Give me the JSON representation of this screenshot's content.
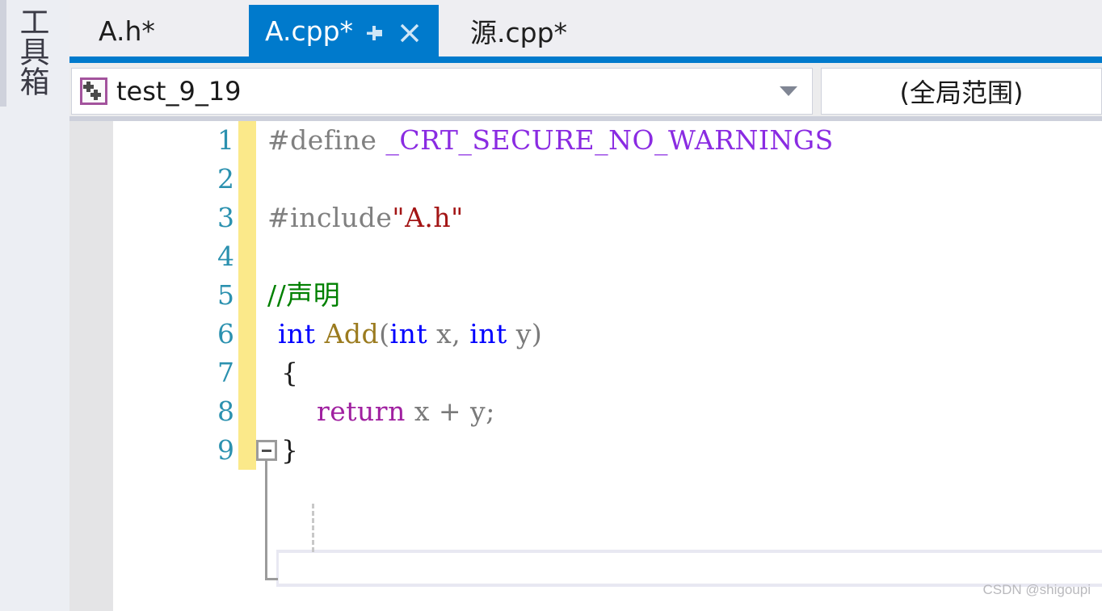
{
  "toolbox": {
    "label": "工具箱"
  },
  "tabs": [
    {
      "label": "A.h*",
      "active": false
    },
    {
      "label": "A.cpp*",
      "active": true
    },
    {
      "label": "源.cpp*",
      "active": false
    }
  ],
  "tab_buttons": {
    "pin_icon": "pin-icon",
    "close_icon": "close-icon"
  },
  "navbar": {
    "project_icon": "cpp-file-icon",
    "left_value": "test_9_19",
    "left_dropdown_icon": "chevron-down-icon",
    "right_value": "(全局范围)"
  },
  "editor": {
    "line_numbers": [
      "1",
      "2",
      "3",
      "4",
      "5",
      "6",
      "7",
      "8",
      "9"
    ],
    "collapse_icon": "minus-collapse-icon",
    "lines": [
      {
        "number": "1",
        "text": "#define _CRT_SECURE_NO_WARNINGS",
        "tokens": [
          {
            "text": "#define ",
            "type": "preprocessor"
          },
          {
            "text": "_CRT_SECURE_NO_WARNINGS",
            "type": "macro"
          }
        ]
      },
      {
        "number": "2",
        "text": "",
        "tokens": []
      },
      {
        "number": "3",
        "text": "#include\"A.h\"",
        "tokens": [
          {
            "text": "#include",
            "type": "preprocessor"
          },
          {
            "text": "\"A.h\"",
            "type": "string"
          }
        ]
      },
      {
        "number": "4",
        "text": "",
        "tokens": []
      },
      {
        "number": "5",
        "text": "//声明",
        "tokens": [
          {
            "text": "//声明",
            "type": "comment"
          }
        ]
      },
      {
        "number": "6",
        "text": "int Add(int x, int y)",
        "tokens": [
          {
            "text": "int",
            "type": "keyword"
          },
          {
            "text": " ",
            "type": "plain"
          },
          {
            "text": "Add",
            "type": "function"
          },
          {
            "text": "(",
            "type": "plain"
          },
          {
            "text": "int",
            "type": "keyword"
          },
          {
            "text": " x, ",
            "type": "plain"
          },
          {
            "text": "int",
            "type": "keyword"
          },
          {
            "text": " y)",
            "type": "plain"
          }
        ]
      },
      {
        "number": "7",
        "text": "{",
        "tokens": [
          {
            "text": "{",
            "type": "brace"
          }
        ]
      },
      {
        "number": "8",
        "text": "    return x + y;",
        "tokens": [
          {
            "text": "    ",
            "type": "plain"
          },
          {
            "text": "return",
            "type": "control"
          },
          {
            "text": " x + y;",
            "type": "plain"
          }
        ]
      },
      {
        "number": "9",
        "text": "}",
        "tokens": [
          {
            "text": "}",
            "type": "brace"
          }
        ]
      }
    ]
  },
  "watermark": {
    "text": "CSDN @shigoupi"
  },
  "colors": {
    "accent_blue": "#007acc",
    "change_bar_yellow": "#fbe98a",
    "linenum_teal": "#2b91af",
    "macro_purple": "#8a2be2",
    "string_red": "#a31515",
    "comment_green": "#008000",
    "keyword_blue": "#0000ff",
    "function_gold": "#9b7b1f",
    "control_magenta": "#a020a0",
    "project_icon_border": "#a3539d"
  }
}
